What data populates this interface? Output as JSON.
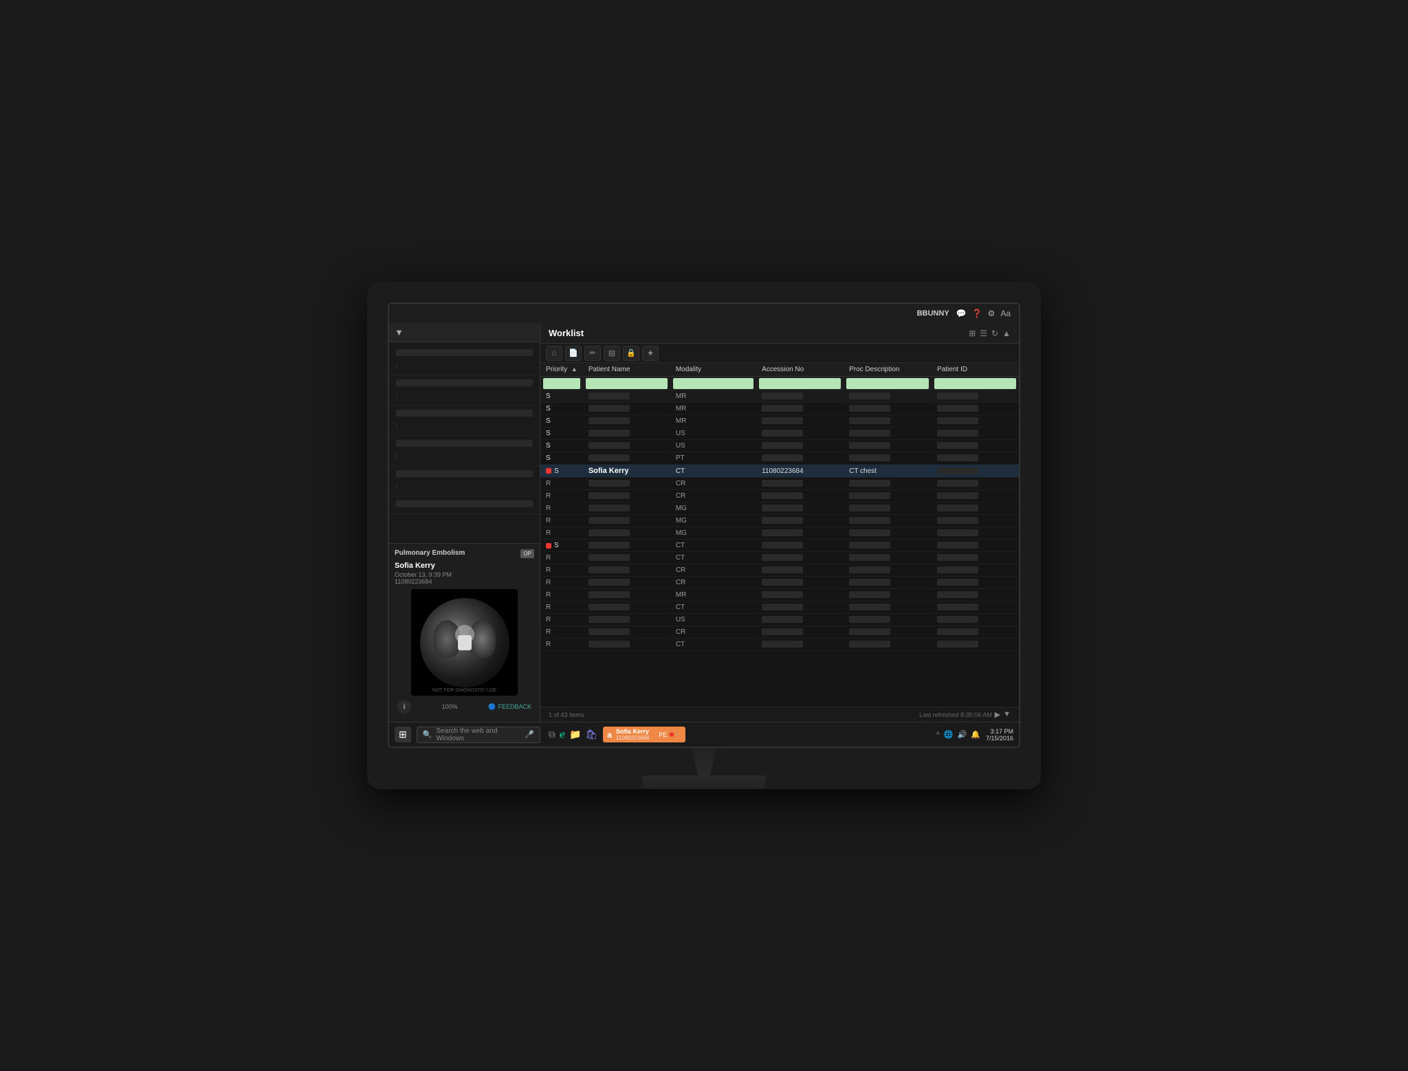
{
  "app": {
    "title": "Worklist",
    "user": "BBUNNY",
    "refreshed": "Last refreshed 8:35:06 AM",
    "items_count": "1 of 43 items"
  },
  "topbar": {
    "user": "BBUNNY",
    "icons": [
      "chat",
      "help",
      "settings",
      "font"
    ]
  },
  "toolbar": {
    "buttons": [
      "home",
      "document",
      "edit",
      "list",
      "lock",
      "star"
    ]
  },
  "table": {
    "columns": [
      "Priority",
      "Patient Name",
      "Modality",
      "Accession No",
      "Proc Description",
      "Patient ID"
    ],
    "selected_row": {
      "priority": "S",
      "patient_name": "Sofia Kerry",
      "modality": "CT",
      "accession": "11080223684",
      "proc_desc": "CT chest",
      "patient_id": ""
    },
    "rows": [
      {
        "priority": "S",
        "flag": false,
        "patient_name": "",
        "modality": "MR",
        "accession": "",
        "proc_desc": "",
        "patient_id": ""
      },
      {
        "priority": "S",
        "flag": false,
        "patient_name": "",
        "modality": "MR",
        "accession": "",
        "proc_desc": "",
        "patient_id": ""
      },
      {
        "priority": "S",
        "flag": false,
        "patient_name": "",
        "modality": "MR",
        "accession": "",
        "proc_desc": "",
        "patient_id": ""
      },
      {
        "priority": "S",
        "flag": false,
        "patient_name": "",
        "modality": "US",
        "accession": "",
        "proc_desc": "",
        "patient_id": ""
      },
      {
        "priority": "S",
        "flag": false,
        "patient_name": "",
        "modality": "US",
        "accession": "",
        "proc_desc": "",
        "patient_id": ""
      },
      {
        "priority": "S",
        "flag": false,
        "patient_name": "",
        "modality": "PT",
        "accession": "",
        "proc_desc": "",
        "patient_id": ""
      },
      {
        "priority": "S",
        "flag": true,
        "patient_name": "Sofia Kerry",
        "modality": "CT",
        "accession": "11080223684",
        "proc_desc": "CT chest",
        "patient_id": "",
        "selected": true
      },
      {
        "priority": "R",
        "flag": false,
        "patient_name": "",
        "modality": "CR",
        "accession": "",
        "proc_desc": "",
        "patient_id": ""
      },
      {
        "priority": "R",
        "flag": false,
        "patient_name": "",
        "modality": "CR",
        "accession": "",
        "proc_desc": "",
        "patient_id": ""
      },
      {
        "priority": "R",
        "flag": false,
        "patient_name": "",
        "modality": "MG",
        "accession": "",
        "proc_desc": "",
        "patient_id": ""
      },
      {
        "priority": "R",
        "flag": false,
        "patient_name": "",
        "modality": "MG",
        "accession": "",
        "proc_desc": "",
        "patient_id": ""
      },
      {
        "priority": "R",
        "flag": false,
        "patient_name": "",
        "modality": "MG",
        "accession": "",
        "proc_desc": "",
        "patient_id": ""
      },
      {
        "priority": "S",
        "flag": true,
        "patient_name": "",
        "modality": "CT",
        "accession": "",
        "proc_desc": "",
        "patient_id": ""
      },
      {
        "priority": "R",
        "flag": false,
        "patient_name": "",
        "modality": "CT",
        "accession": "",
        "proc_desc": "",
        "patient_id": ""
      },
      {
        "priority": "R",
        "flag": false,
        "patient_name": "",
        "modality": "CR",
        "accession": "",
        "proc_desc": "",
        "patient_id": ""
      },
      {
        "priority": "R",
        "flag": false,
        "patient_name": "",
        "modality": "CR",
        "accession": "",
        "proc_desc": "",
        "patient_id": ""
      },
      {
        "priority": "R",
        "flag": false,
        "patient_name": "",
        "modality": "MR",
        "accession": "",
        "proc_desc": "",
        "patient_id": ""
      },
      {
        "priority": "R",
        "flag": false,
        "patient_name": "",
        "modality": "CT",
        "accession": "",
        "proc_desc": "",
        "patient_id": ""
      },
      {
        "priority": "R",
        "flag": false,
        "patient_name": "",
        "modality": "US",
        "accession": "",
        "proc_desc": "",
        "patient_id": ""
      },
      {
        "priority": "R",
        "flag": false,
        "patient_name": "",
        "modality": "CR",
        "accession": "",
        "proc_desc": "",
        "patient_id": ""
      },
      {
        "priority": "R",
        "flag": false,
        "patient_name": "",
        "modality": "CT",
        "accession": "",
        "proc_desc": "",
        "patient_id": ""
      }
    ]
  },
  "patient_card": {
    "diagnosis": "Pulmonary Embolism",
    "name": "Sofia Kerry",
    "date": "October 13, 9:39 PM",
    "id": "11080223684",
    "badge": "OP",
    "not_diagnostic": "NOT FOR DIAGNOSTIC USE",
    "zoom": "100%"
  },
  "taskbar": {
    "search_placeholder": "Search the web and Windows",
    "app_name": "Sofia Kerry",
    "app_id": "11080223684",
    "time": "3:17 PM",
    "date": "7/15/2016",
    "pe_label": "PE"
  },
  "left_panel": {
    "items": [
      {
        "label": "",
        "sub": ""
      },
      {
        "label": "",
        "sub": ""
      },
      {
        "label": "",
        "sub": ""
      },
      {
        "label": "",
        "sub": ""
      },
      {
        "label": "",
        "sub": ""
      },
      {
        "label": "",
        "sub": ""
      }
    ]
  }
}
